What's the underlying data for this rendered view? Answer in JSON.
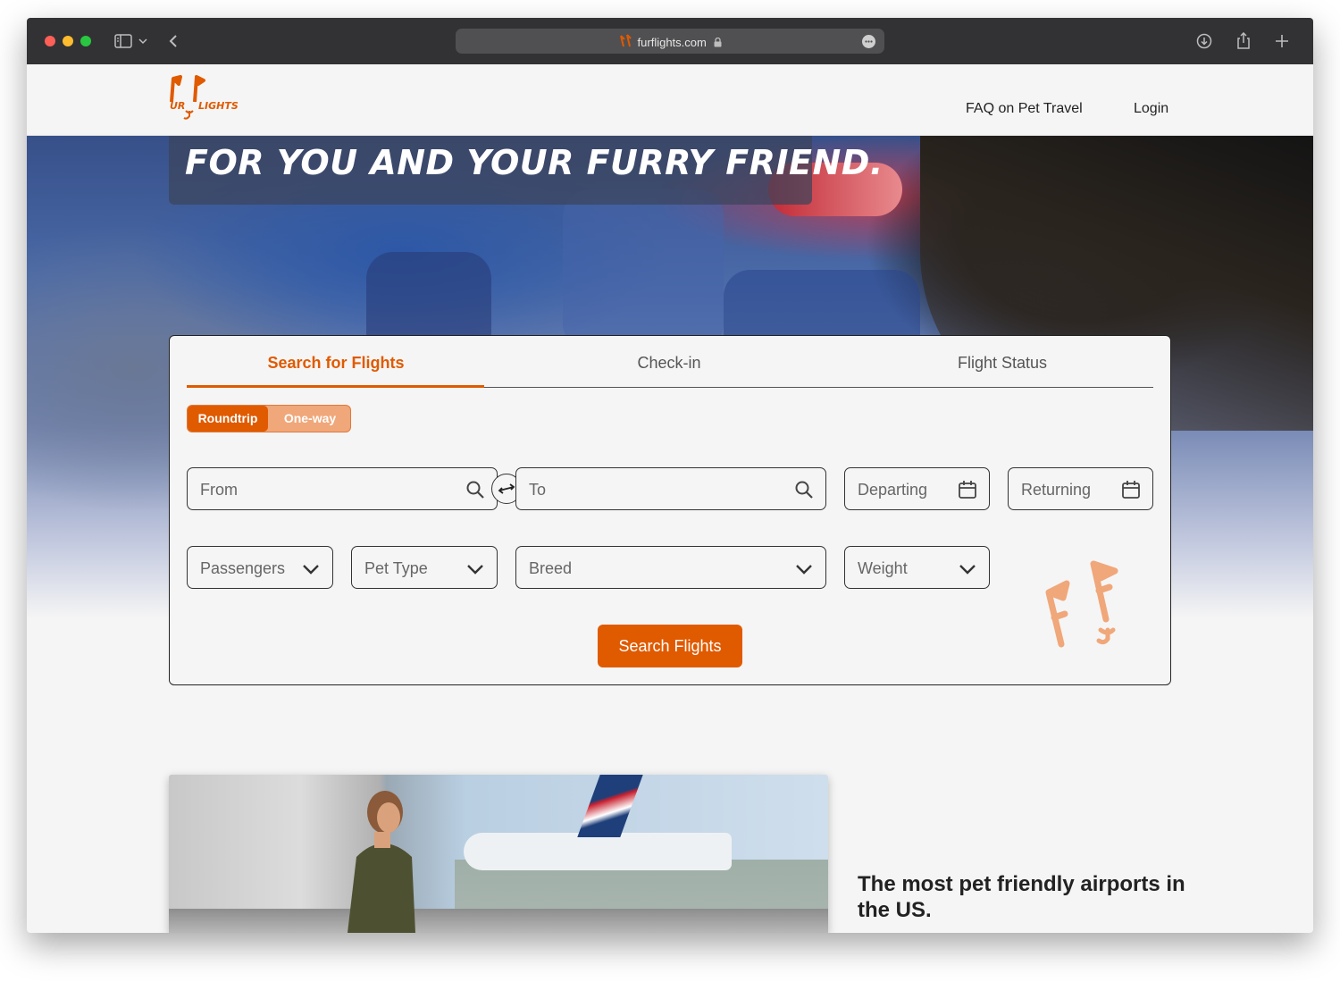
{
  "browser": {
    "url": "furflights.com"
  },
  "header": {
    "logo_text": "FurFlights",
    "nav": [
      {
        "label": "FAQ on Pet Travel"
      },
      {
        "label": "Login"
      }
    ]
  },
  "hero": {
    "title": "FOR YOU AND YOUR FURRY FRIEND."
  },
  "search": {
    "tabs": [
      {
        "label": "Search for Flights",
        "active": true
      },
      {
        "label": "Check-in",
        "active": false
      },
      {
        "label": "Flight Status",
        "active": false
      }
    ],
    "trip_types": [
      {
        "label": "Roundtrip",
        "active": true
      },
      {
        "label": "One-way",
        "active": false
      }
    ],
    "fields": {
      "from": "From",
      "to": "To",
      "departing": "Departing",
      "returning": "Returning",
      "passengers": "Passengers",
      "pet_type": "Pet Type",
      "breed": "Breed",
      "weight": "Weight"
    },
    "submit_label": "Search Flights"
  },
  "section": {
    "heading": "The most pet friendly airports in the US."
  },
  "colors": {
    "accent": "#e05a00",
    "accent_light": "#f0a77a"
  }
}
